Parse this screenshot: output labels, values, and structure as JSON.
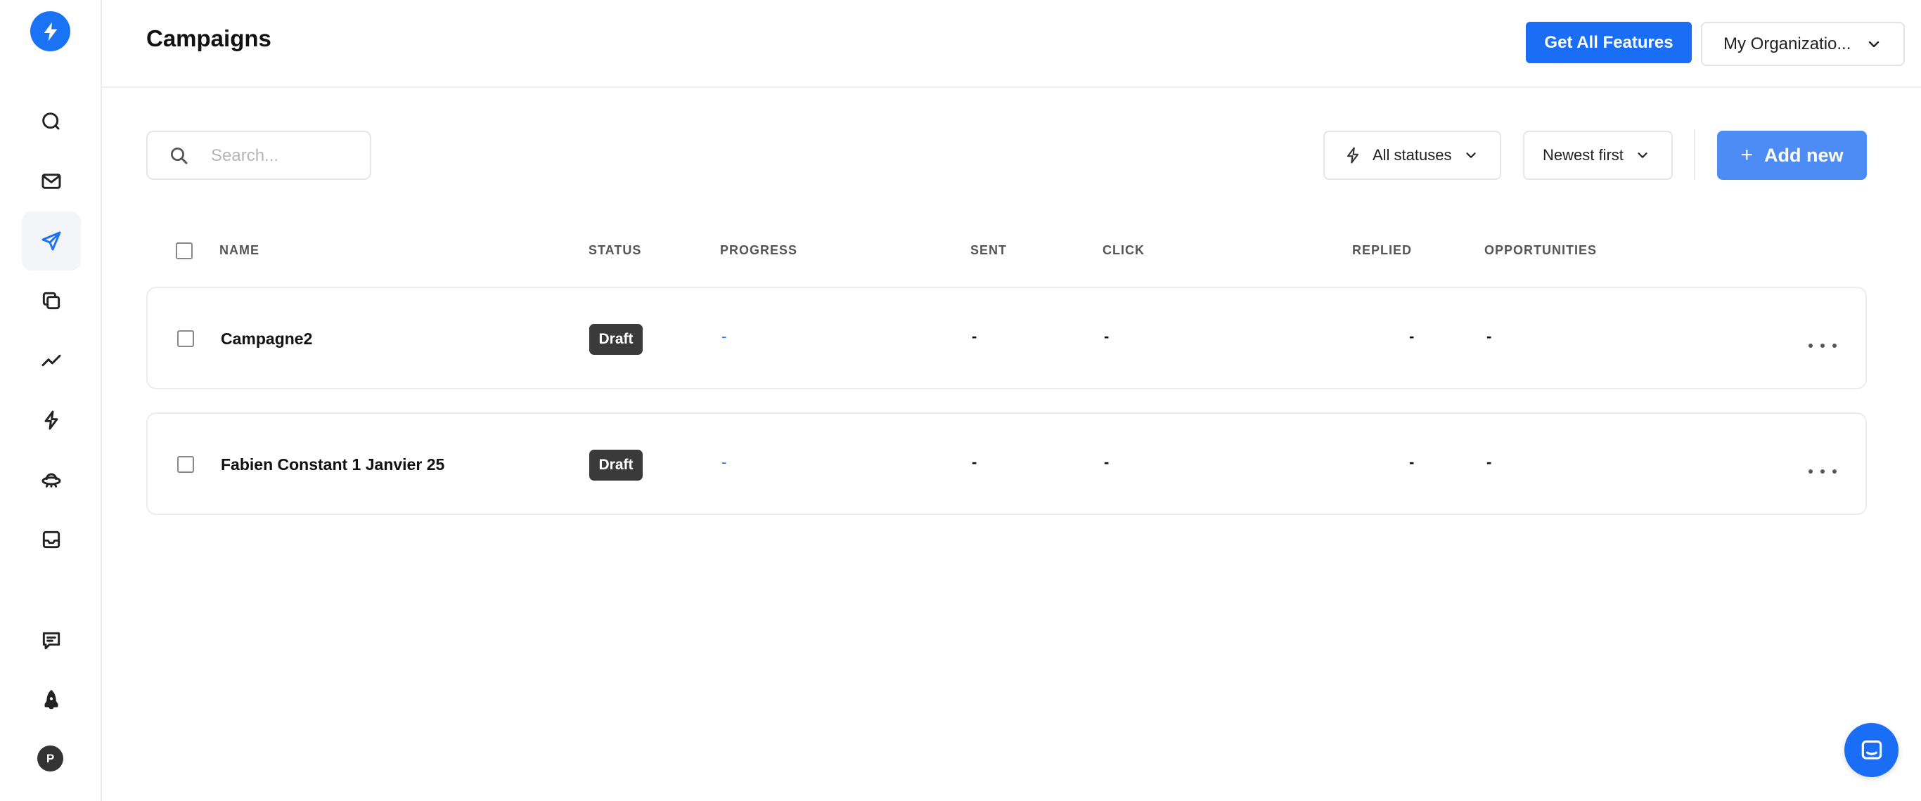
{
  "sidebar": {
    "logo_icon": "lightning-bolt-icon",
    "items": [
      {
        "name": "search",
        "icon": "search-icon"
      },
      {
        "name": "inbox",
        "icon": "mail-icon"
      },
      {
        "name": "campaigns",
        "icon": "send-icon",
        "active": true
      },
      {
        "name": "templates",
        "icon": "copy-icon"
      },
      {
        "name": "analytics",
        "icon": "trend-icon"
      },
      {
        "name": "automations",
        "icon": "bolt-icon"
      },
      {
        "name": "integrations",
        "icon": "ufo-icon"
      },
      {
        "name": "unibox",
        "icon": "inbox-tray-icon"
      }
    ],
    "bottom": [
      {
        "name": "feedback",
        "icon": "chat-icon"
      },
      {
        "name": "onboarding",
        "icon": "rocket-icon"
      }
    ],
    "avatar_initial": "P"
  },
  "header": {
    "title": "Campaigns",
    "features_button": "Get All Features",
    "organization": "My Organizatio..."
  },
  "toolbar": {
    "search_placeholder": "Search...",
    "status_filter": "All statuses",
    "sort": "Newest first",
    "add_button": "Add new"
  },
  "table": {
    "columns": {
      "name": "NAME",
      "status": "STATUS",
      "progress": "PROGRESS",
      "sent": "SENT",
      "click": "CLICK",
      "replied": "REPLIED",
      "opportunities": "OPPORTUNITIES"
    },
    "rows": [
      {
        "name": "Campagne2",
        "status": "Draft",
        "progress": "-",
        "sent": "-",
        "click": "-",
        "replied": "-",
        "opportunities": "-"
      },
      {
        "name": "Fabien Constant 1 Janvier 25",
        "status": "Draft",
        "progress": "-",
        "sent": "-",
        "click": "-",
        "replied": "-",
        "opportunities": "-"
      }
    ]
  },
  "colors": {
    "brand": "#1a73f5",
    "primary_button": "#1a6ef5",
    "add_button": "#4d8cf5",
    "badge": "#3a3a3a"
  }
}
